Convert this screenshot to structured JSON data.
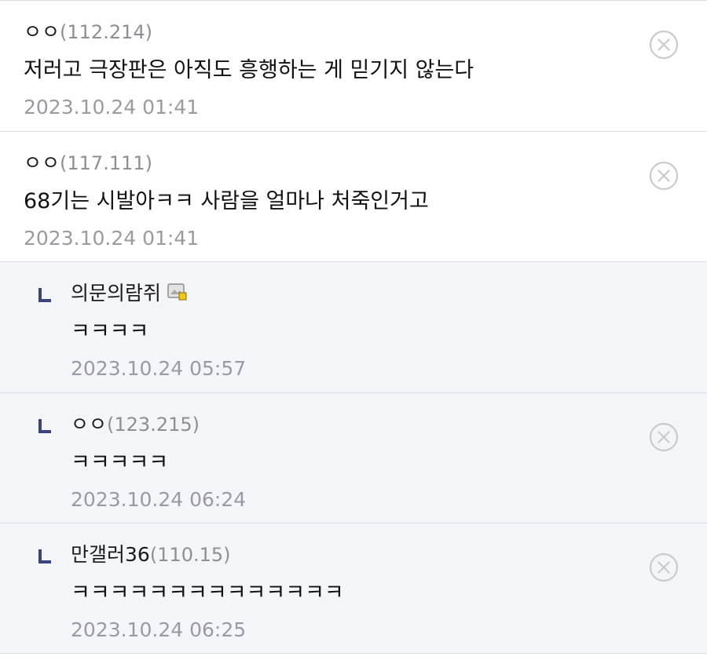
{
  "comments": [
    {
      "nick": "ㅇㅇ",
      "ip": "(112.214)",
      "text": "저러고 극장판은 아직도 흥행하는 게 믿기지 않는다",
      "date": "2023.10.24 01:41"
    },
    {
      "nick": "ㅇㅇ",
      "ip": "(117.111)",
      "text": "68기는 시발아ㅋㅋ 사람을 얼마나 처죽인거고",
      "date": "2023.10.24 01:41"
    }
  ],
  "replies": [
    {
      "nick": "의문의람쥐",
      "ip": "",
      "text": "ㅋㅋㅋㅋ",
      "date": "2023.10.24 05:57"
    },
    {
      "nick": "ㅇㅇ",
      "ip": "(123.215)",
      "text": "ㅋㅋㅋㅋㅋ",
      "date": "2023.10.24 06:24"
    },
    {
      "nick": "만갤러36",
      "ip": "(110.15)",
      "text": "ㅋㅋㅋㅋㅋㅋㅋㅋㅋㅋㅋㅋㅋㅋ",
      "date": "2023.10.24 06:25"
    }
  ],
  "icons": {
    "delete": "close-circle-icon",
    "reply_marker": "reply-arrow-icon",
    "gallog": "gallog-icon"
  },
  "colors": {
    "reply_background": "#f4f5f9",
    "reply_marker": "#3b4380",
    "ip_text": "#8e8e93",
    "date_text": "#9a9aa0",
    "divider": "#dcdee6"
  }
}
